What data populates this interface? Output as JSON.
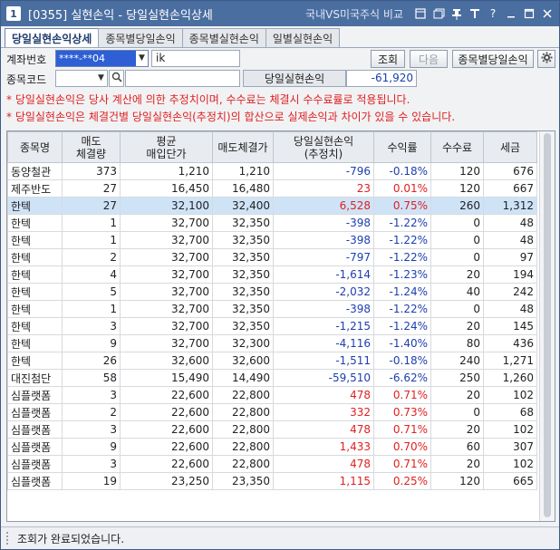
{
  "window": {
    "number": "1",
    "title": "[0355] 실현손익 - 당일실현손익상세",
    "compare_link": "국내VS미국주식 비교",
    "icons": [
      "restore-icon",
      "copy-icon",
      "pin-icon",
      "font-icon",
      "help-icon",
      "minimize-icon",
      "maximize-icon",
      "close-icon"
    ]
  },
  "tabs": [
    {
      "label": "당일실현손익상세",
      "active": true
    },
    {
      "label": "종목별당일손익",
      "active": false
    },
    {
      "label": "종목별실현손익",
      "active": false
    },
    {
      "label": "일별실현손익",
      "active": false
    }
  ],
  "form": {
    "account_label": "계좌번호",
    "account_value": "****-**04",
    "account_name": "ik",
    "query_button": "조회",
    "next_button": "다음",
    "by_stock_button": "종목별당일손익",
    "code_label": "종목코드",
    "code_value": "",
    "code_name": "",
    "pl_label": "당일실현손익",
    "pl_value": "-61,920"
  },
  "notes": [
    "* 당일실현손익은 당사 계산에 의한 추정치이며, 수수료는 체결시 수수료률로 적용됩니다.",
    "* 당일실현손익은 체결건별 당일실현손익(추정치)의 합산으로 실제손익과 차이가 있을 수 있습니다."
  ],
  "table": {
    "headers": [
      [
        "종목명"
      ],
      [
        "매도",
        "체결량"
      ],
      [
        "평균",
        "매입단가"
      ],
      [
        "매도체결가"
      ],
      [
        "당일실현손익",
        "(추정치)"
      ],
      [
        "수익률"
      ],
      [
        "수수료"
      ],
      [
        "세금"
      ]
    ],
    "rows": [
      {
        "name": "동양철관",
        "qty": "373",
        "avg": "1,210",
        "sell": "1,210",
        "pl": "-796",
        "rate": "-0.18%",
        "fee": "120",
        "tax": "676",
        "sign": "neg"
      },
      {
        "name": "제주반도",
        "qty": "27",
        "avg": "16,450",
        "sell": "16,480",
        "pl": "23",
        "rate": "0.01%",
        "fee": "120",
        "tax": "667",
        "sign": "pos"
      },
      {
        "name": "한텍",
        "qty": "27",
        "avg": "32,100",
        "sell": "32,400",
        "pl": "6,528",
        "rate": "0.75%",
        "fee": "260",
        "tax": "1,312",
        "sign": "pos",
        "selected": true
      },
      {
        "name": "한텍",
        "qty": "1",
        "avg": "32,700",
        "sell": "32,350",
        "pl": "-398",
        "rate": "-1.22%",
        "fee": "0",
        "tax": "48",
        "sign": "neg"
      },
      {
        "name": "한텍",
        "qty": "1",
        "avg": "32,700",
        "sell": "32,350",
        "pl": "-398",
        "rate": "-1.22%",
        "fee": "0",
        "tax": "48",
        "sign": "neg"
      },
      {
        "name": "한텍",
        "qty": "2",
        "avg": "32,700",
        "sell": "32,350",
        "pl": "-797",
        "rate": "-1.22%",
        "fee": "0",
        "tax": "97",
        "sign": "neg"
      },
      {
        "name": "한텍",
        "qty": "4",
        "avg": "32,700",
        "sell": "32,350",
        "pl": "-1,614",
        "rate": "-1.23%",
        "fee": "20",
        "tax": "194",
        "sign": "neg"
      },
      {
        "name": "한텍",
        "qty": "5",
        "avg": "32,700",
        "sell": "32,350",
        "pl": "-2,032",
        "rate": "-1.24%",
        "fee": "40",
        "tax": "242",
        "sign": "neg"
      },
      {
        "name": "한텍",
        "qty": "1",
        "avg": "32,700",
        "sell": "32,350",
        "pl": "-398",
        "rate": "-1.22%",
        "fee": "0",
        "tax": "48",
        "sign": "neg"
      },
      {
        "name": "한텍",
        "qty": "3",
        "avg": "32,700",
        "sell": "32,350",
        "pl": "-1,215",
        "rate": "-1.24%",
        "fee": "20",
        "tax": "145",
        "sign": "neg"
      },
      {
        "name": "한텍",
        "qty": "9",
        "avg": "32,700",
        "sell": "32,300",
        "pl": "-4,116",
        "rate": "-1.40%",
        "fee": "80",
        "tax": "436",
        "sign": "neg"
      },
      {
        "name": "한텍",
        "qty": "26",
        "avg": "32,600",
        "sell": "32,600",
        "pl": "-1,511",
        "rate": "-0.18%",
        "fee": "240",
        "tax": "1,271",
        "sign": "neg"
      },
      {
        "name": "대진첨단",
        "qty": "58",
        "avg": "15,490",
        "sell": "14,490",
        "pl": "-59,510",
        "rate": "-6.62%",
        "fee": "250",
        "tax": "1,260",
        "sign": "neg"
      },
      {
        "name": "심플랫폼",
        "qty": "3",
        "avg": "22,600",
        "sell": "22,800",
        "pl": "478",
        "rate": "0.71%",
        "fee": "20",
        "tax": "102",
        "sign": "pos"
      },
      {
        "name": "심플랫폼",
        "qty": "2",
        "avg": "22,600",
        "sell": "22,800",
        "pl": "332",
        "rate": "0.73%",
        "fee": "0",
        "tax": "68",
        "sign": "pos"
      },
      {
        "name": "심플랫폼",
        "qty": "3",
        "avg": "22,600",
        "sell": "22,800",
        "pl": "478",
        "rate": "0.71%",
        "fee": "20",
        "tax": "102",
        "sign": "pos"
      },
      {
        "name": "심플랫폼",
        "qty": "9",
        "avg": "22,600",
        "sell": "22,800",
        "pl": "1,433",
        "rate": "0.70%",
        "fee": "60",
        "tax": "307",
        "sign": "pos"
      },
      {
        "name": "심플랫폼",
        "qty": "3",
        "avg": "22,600",
        "sell": "22,800",
        "pl": "478",
        "rate": "0.71%",
        "fee": "20",
        "tax": "102",
        "sign": "pos"
      },
      {
        "name": "심플랫폼",
        "qty": "19",
        "avg": "23,250",
        "sell": "23,350",
        "pl": "1,115",
        "rate": "0.25%",
        "fee": "120",
        "tax": "665",
        "sign": "pos"
      }
    ]
  },
  "status": {
    "message": "조회가 완료되었습니다."
  },
  "colors": {
    "titlebar": "#4a6ea0",
    "negative": "#1c3fae",
    "positive": "#e02020",
    "selected_row": "#cfe3f7"
  }
}
